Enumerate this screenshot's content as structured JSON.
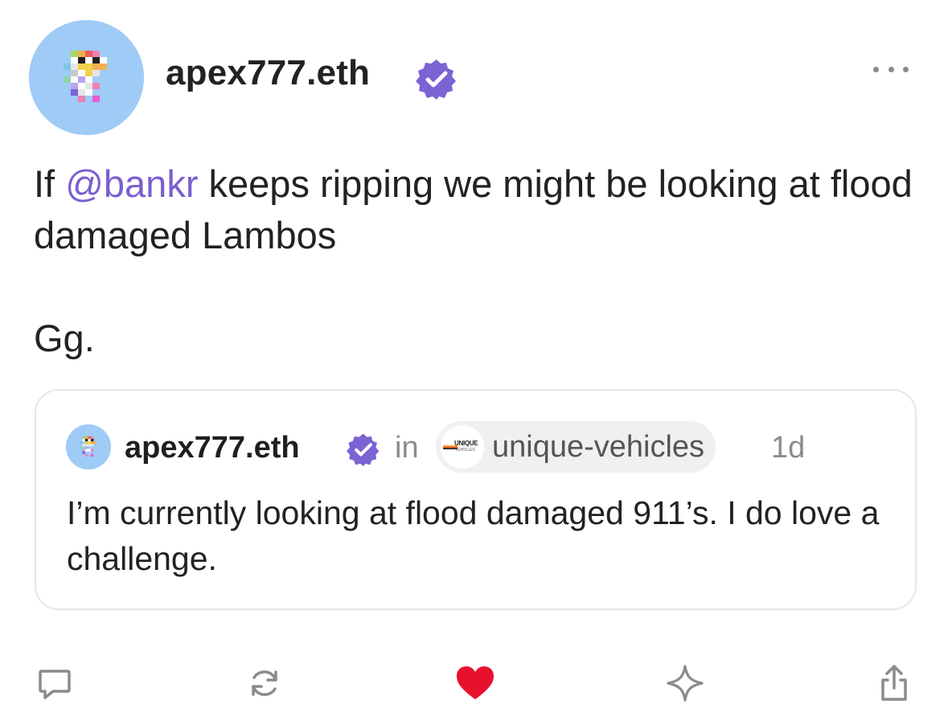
{
  "post": {
    "author": {
      "username": "apex777.eth",
      "verified": true
    },
    "text": {
      "line_before_mention": "If ",
      "mention": "@bankr",
      "line_after_mention": " keeps ripping we might be looking at flood damaged Lambos",
      "second_paragraph": "Gg."
    },
    "quoted_cast": {
      "author": "apex777.eth",
      "in_label": "in",
      "channel": "unique-vehicles",
      "channel_logo_text": "UNIQUE",
      "channel_logo_subtext": "VEHICLES",
      "time": "1d",
      "text": "I’m currently looking at flood damaged 911’s. I do love a challenge."
    },
    "actions": {
      "reply_icon": "comment-icon",
      "recast_icon": "recast-icon",
      "like_icon": "heart-icon",
      "like_state": "liked",
      "bookmark_icon": "sparkle-icon",
      "share_icon": "share-icon"
    }
  },
  "colors": {
    "accent_purple": "#7a5fd0",
    "verified_badge": "#7c63d4",
    "like_red": "#e8112d",
    "avatar_bg": "#9fcbf7",
    "muted_text": "#8a8a8f",
    "card_border": "#e6e6ea"
  }
}
